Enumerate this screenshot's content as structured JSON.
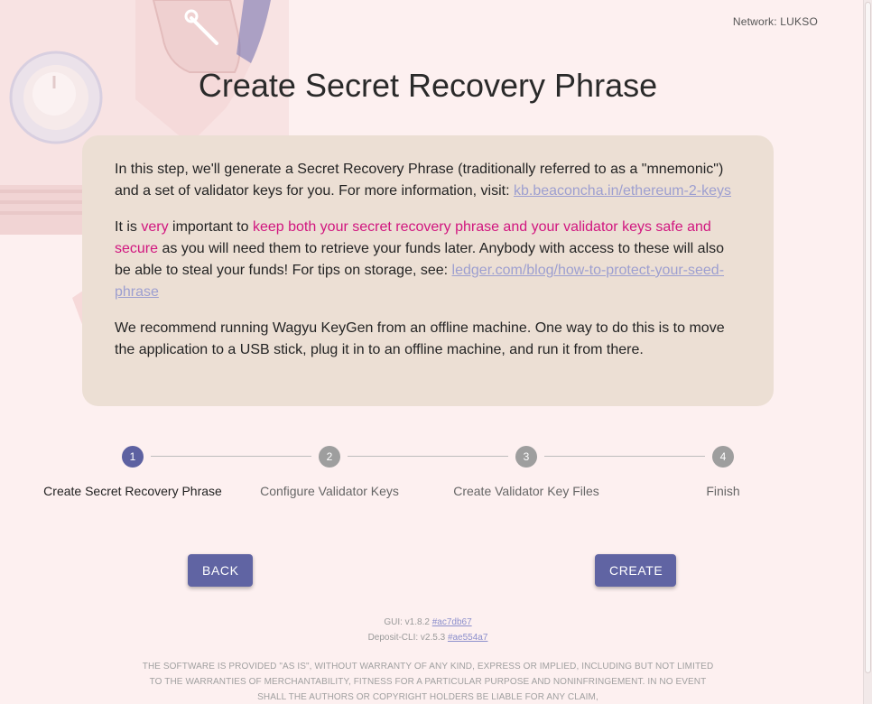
{
  "header": {
    "network": "Network: LUKSO"
  },
  "title": "Create Secret Recovery Phrase",
  "info": {
    "p1_text": "In this step, we'll generate a Secret Recovery Phrase (traditionally referred to as a \"mnemonic\") and a set of validator keys for you. For more information, visit: ",
    "p1_link": "kb.beaconcha.in/ethereum-2-keys",
    "p2_a": "It is ",
    "p2_very": "very",
    "p2_b": " important to ",
    "p2_emph": "keep both your secret recovery phrase and your validator keys safe and secure",
    "p2_c": " as you will need them to retrieve your funds later. Anybody with access to these will also be able to steal your funds! For tips on storage, see: ",
    "p2_link": "ledger.com/blog/how-to-protect-your-seed-phrase",
    "p3_text": "We recommend running Wagyu KeyGen from an offline machine. One way to do this is to move the application to a USB stick, plug it in to an offline machine, and run it from there."
  },
  "stepper": {
    "steps": [
      {
        "number": "1",
        "label": "Create Secret Recovery Phrase"
      },
      {
        "number": "2",
        "label": "Configure Validator Keys"
      },
      {
        "number": "3",
        "label": "Create Validator Key Files"
      },
      {
        "number": "4",
        "label": "Finish"
      }
    ],
    "active_index": 0
  },
  "buttons": {
    "back": "BACK",
    "create": "CREATE"
  },
  "versions": {
    "gui_label": "GUI: v1.8.2 ",
    "gui_hash": "#ac7db67",
    "cli_label": "Deposit-CLI: v2.5.3 ",
    "cli_hash": "#ae554a7"
  },
  "license": "THE SOFTWARE IS PROVIDED \"AS IS\", WITHOUT WARRANTY OF ANY KIND, EXPRESS OR IMPLIED, INCLUDING BUT NOT LIMITED TO THE WARRANTIES OF MERCHANTABILITY, FITNESS FOR A PARTICULAR PURPOSE AND NONINFRINGEMENT. IN NO EVENT SHALL THE AUTHORS OR COPYRIGHT HOLDERS BE LIABLE FOR ANY CLAIM,",
  "colors": {
    "accent": "#6064a3",
    "emphasis": "#d1167f",
    "link": "#9d9fd0",
    "card": "#ecdfd4",
    "background": "#fdf0f0"
  }
}
